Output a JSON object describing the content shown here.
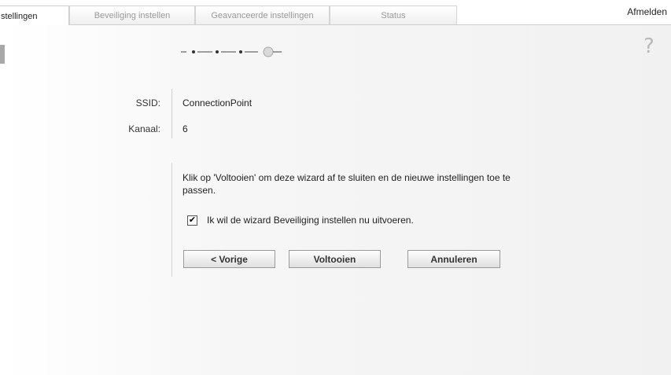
{
  "tabs": [
    {
      "label": "stellingen",
      "active": true
    },
    {
      "label": "Beveiliging instellen",
      "active": false
    },
    {
      "label": "Geavanceerde instellingen",
      "active": false
    },
    {
      "label": "Status",
      "active": false
    }
  ],
  "header": {
    "logout_label": "Afmelden"
  },
  "wizard": {
    "steps_total": 5,
    "current_step": 5,
    "help_icon": "?"
  },
  "fields": {
    "ssid_label": "SSID:",
    "ssid_value": "ConnectionPoint",
    "channel_label": "Kanaal:",
    "channel_value": "6"
  },
  "info_text": "Klik op 'Voltooien' om deze wizard af te sluiten en de nieuwe instellingen toe te passen.",
  "checkbox": {
    "label": "Ik wil de wizard Beveiliging instellen nu uitvoeren.",
    "checked": true,
    "mark": "✔"
  },
  "buttons": {
    "prev": "< Vorige",
    "finish": "Voltooien",
    "cancel": "Annuleren"
  },
  "colors": {
    "step_active": "#b0b0b0",
    "step_done": "#444444"
  }
}
